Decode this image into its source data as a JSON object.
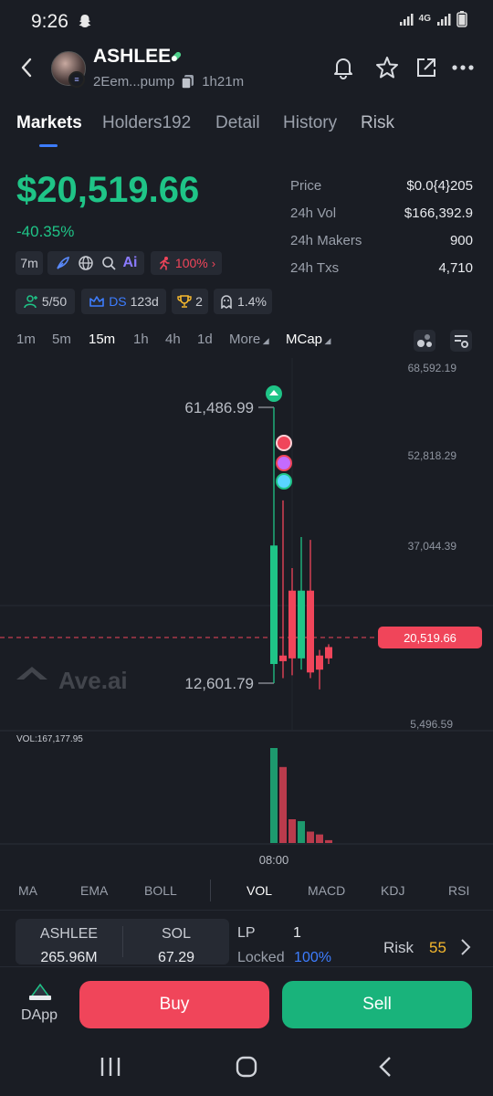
{
  "status_bar": {
    "time": "9:26",
    "network": "4G"
  },
  "header": {
    "token_name": "ASHLEE",
    "address": "2Eem...pump",
    "age": "1h21m"
  },
  "tabs": [
    {
      "label": "Markets"
    },
    {
      "label": "Holders192"
    },
    {
      "label": "Detail"
    },
    {
      "label": "History"
    },
    {
      "label": "Risk"
    }
  ],
  "price": {
    "market_cap": "$20,519.66",
    "change": "-40.35%"
  },
  "stats": [
    {
      "label": "Price",
      "value": "$0.0{4}205"
    },
    {
      "label": "24h Vol",
      "value": "$166,392.9"
    },
    {
      "label": "24h Makers",
      "value": "900"
    },
    {
      "label": "24h Txs",
      "value": "4,710"
    }
  ],
  "chips_row1": {
    "age": "7m",
    "ai": "Ai",
    "pct": "100%"
  },
  "chips_row2": {
    "holders": "5/50",
    "ds_label": "DS",
    "ds_days": "123d",
    "trophy": "2",
    "pct": "1.4%"
  },
  "timeframes": [
    "1m",
    "5m",
    "15m",
    "1h",
    "4h",
    "1d",
    "More",
    "MCap"
  ],
  "colors": {
    "up": "#1fc487",
    "down": "#f0455a",
    "accent": "#3d7dff",
    "background": "#1a1d24"
  },
  "chart_data": {
    "type": "candlestick",
    "y_ticks": [
      "68,592.19",
      "52,818.29",
      "37,044.39",
      "5,496.59"
    ],
    "current_value_label": "20,519.66",
    "high_label": "61,486.99",
    "low_label": "12,601.79",
    "x_tick": "08:00",
    "watermark": "Ave.ai",
    "volume_label": "VOL:167,177.95",
    "candles": [
      {
        "open": 16000,
        "close": 37000,
        "high": 61487,
        "low": 12602,
        "dir": "up"
      },
      {
        "open": 17500,
        "close": 16500,
        "high": 45000,
        "low": 13500,
        "dir": "down"
      },
      {
        "open": 29000,
        "close": 17000,
        "high": 33000,
        "low": 14000,
        "dir": "down"
      },
      {
        "open": 17000,
        "close": 29000,
        "high": 38500,
        "low": 15000,
        "dir": "up"
      },
      {
        "open": 29000,
        "close": 14500,
        "high": 38000,
        "low": 13500,
        "dir": "down"
      },
      {
        "open": 17500,
        "close": 15000,
        "high": 18500,
        "low": 11500,
        "dir": "down"
      },
      {
        "open": 19000,
        "close": 17000,
        "high": 19500,
        "low": 16000,
        "dir": "down"
      }
    ],
    "volumes": [
      1.0,
      0.8,
      0.25,
      0.23,
      0.12,
      0.09,
      0.03
    ]
  },
  "indicators": [
    "MA",
    "EMA",
    "BOLL",
    "VOL",
    "MACD",
    "KDJ",
    "RSI"
  ],
  "pair": {
    "left_label": "ASHLEE",
    "left_value": "265.96M",
    "right_label": "SOL",
    "right_value": "67.29"
  },
  "lp": {
    "label": "LP",
    "value": "1",
    "locked_label": "Locked",
    "locked_value": "100%"
  },
  "risk": {
    "label": "Risk",
    "score": "55"
  },
  "actions": {
    "dapp": "DApp",
    "buy": "Buy",
    "sell": "Sell"
  }
}
